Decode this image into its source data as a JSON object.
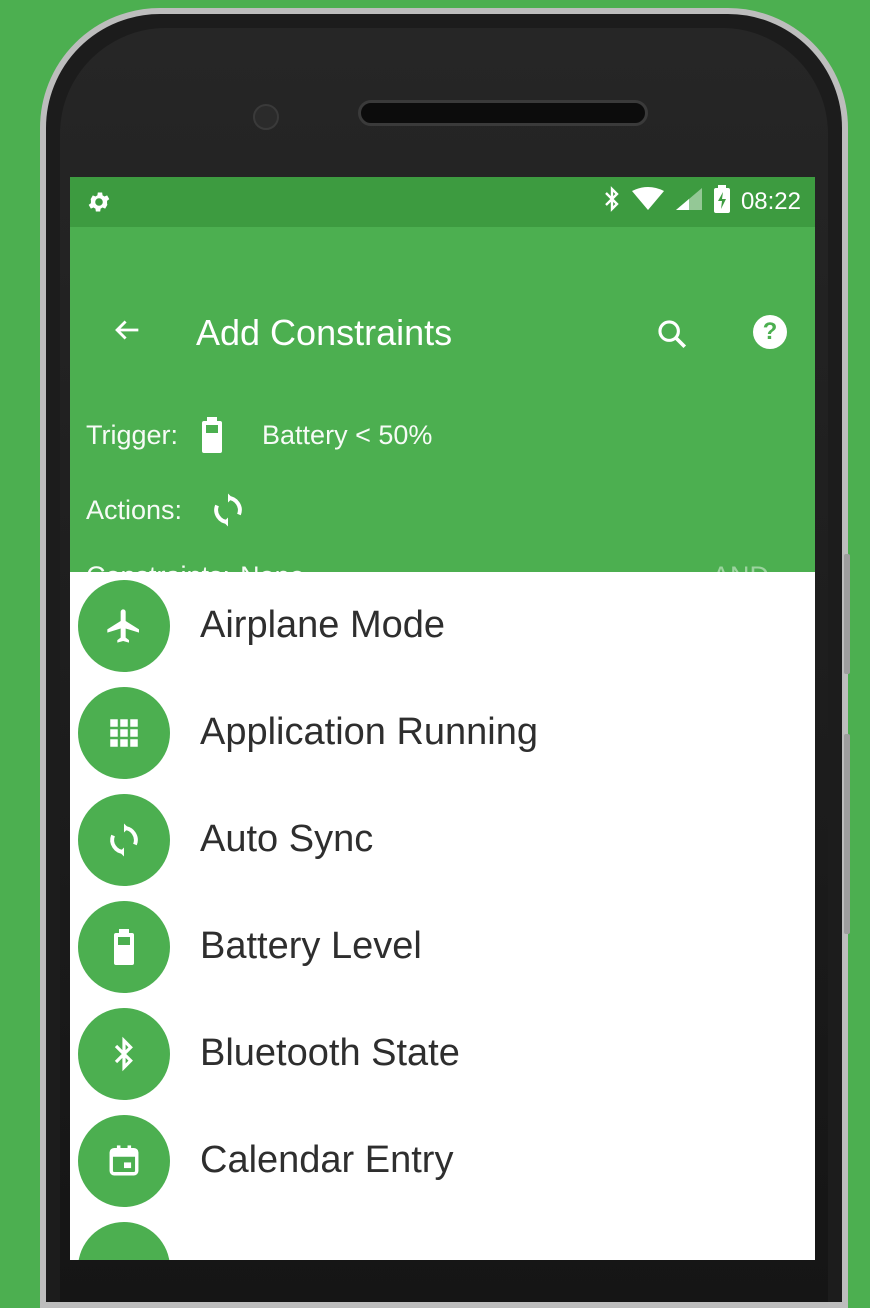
{
  "status_bar": {
    "time": "08:22",
    "left_icon": "gear-icon",
    "right_icons": [
      "bluetooth-icon",
      "wifi-icon",
      "signal-icon",
      "battery-charging-icon"
    ]
  },
  "app_bar": {
    "title": "Add Constraints",
    "back_icon": "arrow-back-icon",
    "search_icon": "search-icon",
    "help_icon": "help-icon",
    "help_glyph": "?"
  },
  "summary": {
    "trigger_label": "Trigger:",
    "trigger_value": "Battery < 50%",
    "actions_label": "Actions:",
    "constraints_label": "Constraints:",
    "constraints_value": "None",
    "logic_operator": "AND"
  },
  "constraints_list": [
    {
      "label": "Airplane Mode",
      "icon": "airplane-icon"
    },
    {
      "label": "Application Running",
      "icon": "apps-grid-icon"
    },
    {
      "label": "Auto Sync",
      "icon": "sync-icon"
    },
    {
      "label": "Battery Level",
      "icon": "battery-icon"
    },
    {
      "label": "Bluetooth State",
      "icon": "bluetooth-icon"
    },
    {
      "label": "Calendar Entry",
      "icon": "calendar-icon"
    }
  ],
  "colors": {
    "primary": "#4caf50",
    "primary_dark": "#3d9b40",
    "background": "#ffffff",
    "text": "#2e2e2e"
  }
}
